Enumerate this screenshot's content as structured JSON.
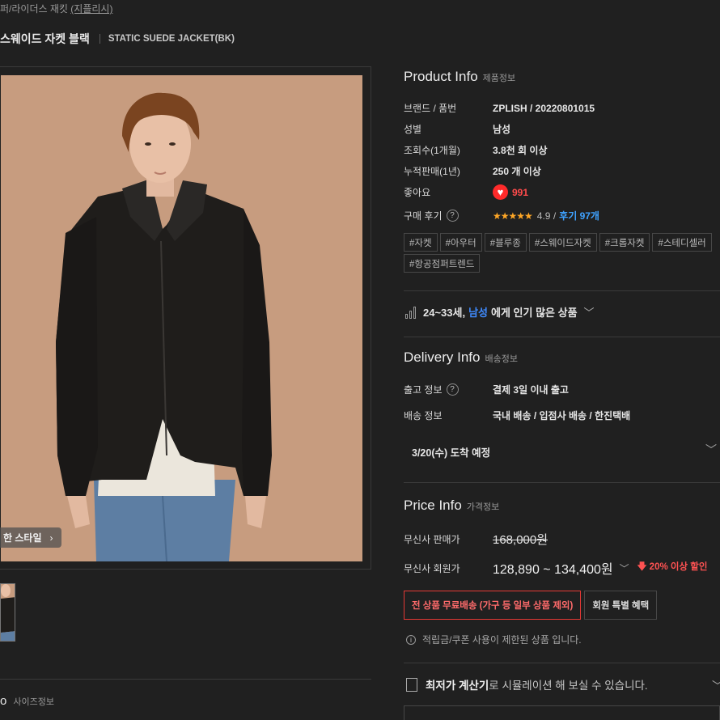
{
  "breadcrumb": {
    "prefix": "퍼/라이더스 재킷 ",
    "link": "(지플리시)"
  },
  "product": {
    "title_kr": "스웨이드 자켓 블랙",
    "title_en": "STATIC SUEDE JACKET(BK)"
  },
  "gallery": {
    "style_button": "한 스타일",
    "style_chevron": "›"
  },
  "size_section": {
    "title": "o",
    "subtitle": "사이즈정보"
  },
  "product_info": {
    "title": "Product Info",
    "subtitle": "제품정보",
    "rows": [
      {
        "label": "브랜드 / 품번",
        "value": "ZPLISH /  20220801015"
      },
      {
        "label": "성별",
        "value": "남성"
      },
      {
        "label": "조회수(1개월)",
        "value": "3.8천 회 이상"
      },
      {
        "label": "누적판매(1년)",
        "value": "250 개 이상"
      }
    ],
    "likes_label": "좋아요",
    "likes_count": "991",
    "review_label": "구매 후기",
    "review_stars": "★★★★★",
    "review_rating": "4.9 /",
    "review_link": "후기 97개",
    "help_glyph": "?",
    "heart_glyph": "♥"
  },
  "tags": [
    "#자켓",
    "#아우터",
    "#블루종",
    "#스웨이드자켓",
    "#크롭자켓",
    "#스테디셀러",
    "#항공점퍼트렌드"
  ],
  "popular": {
    "prefix": "24~33세,",
    "highlight": "남성",
    "suffix": "에게 인기 많은 상품",
    "chevron": "﹀"
  },
  "delivery_info": {
    "title": "Delivery Info",
    "subtitle": "배송정보",
    "ship_label": "출고 정보",
    "ship_value": "결제 3일 이내 출고",
    "method_label": "배송 정보",
    "method_value": "국내 배송 /  입점사 배송 /  한진택배",
    "arrival": "3/20(수) 도착 예정",
    "arrival_chevron": "﹀"
  },
  "price_info": {
    "title": "Price Info",
    "subtitle": "가격정보",
    "sale_label": "무신사 판매가",
    "sale_price": "168,000원",
    "member_label": "무신사 회원가",
    "member_price": "128,890 ~ 134,400원",
    "member_chevron": "﹀",
    "discount": "🡇 20% 이상 할인"
  },
  "promo": {
    "free_shipping": "전 상품 무료배송 (가구 등 일부 상품 제외)",
    "member_benefit": "회원 특별 혜택"
  },
  "notice": {
    "icon": "i",
    "text": "적립금/쿠폰 사용이 제한된 상품 입니다."
  },
  "calculator": {
    "bold": "최저가 계산기",
    "rest": "로 시뮬레이션 해 보실 수 있습니다.",
    "chevron": "﹀"
  }
}
